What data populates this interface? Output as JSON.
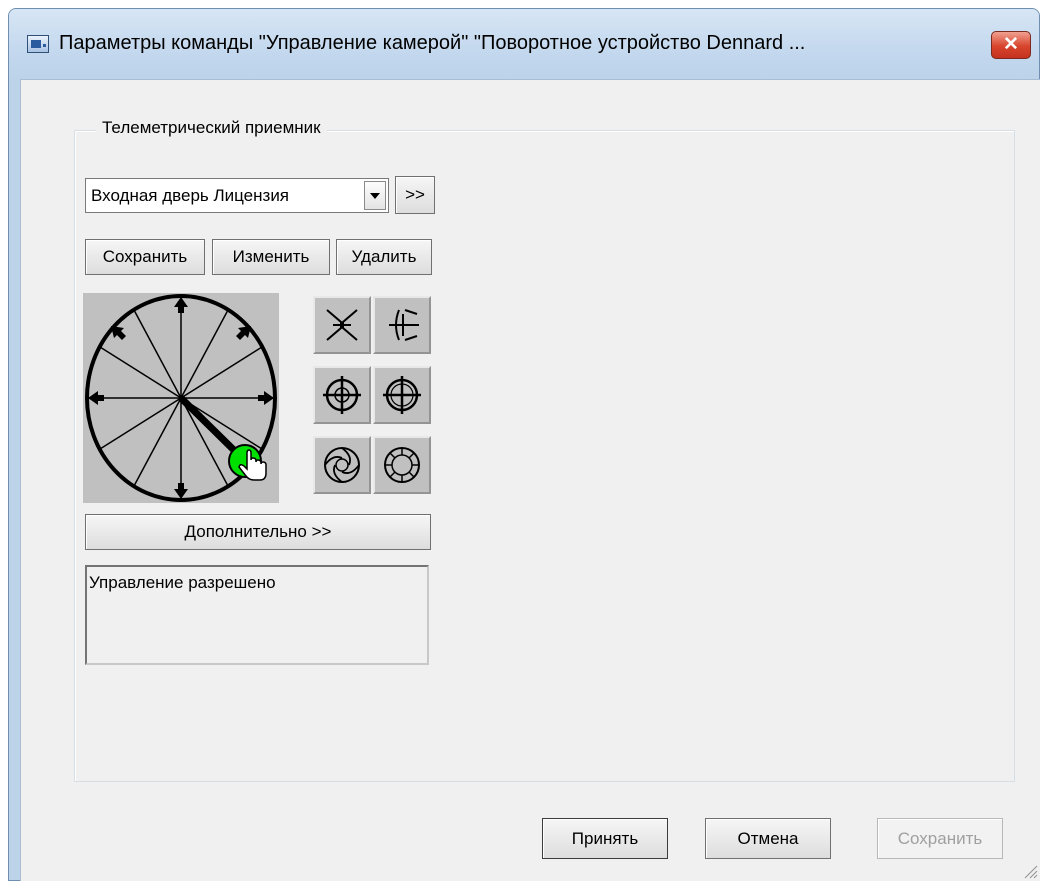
{
  "window": {
    "title": "Параметры команды \"Управление камерой\" \"Поворотное устройство Dennard ...",
    "close_label": "✕"
  },
  "telemetry": {
    "group_title": "Телеметрический приемник",
    "receiver_value": "Входная дверь Лицензия",
    "expand_label": ">>",
    "save_label": "Сохранить",
    "change_label": "Изменить",
    "delete_label": "Удалить"
  },
  "ptz": {
    "lens_buttons": [
      {
        "name": "zoom-out-icon"
      },
      {
        "name": "zoom-in-icon"
      },
      {
        "name": "focus-near-icon"
      },
      {
        "name": "focus-far-icon"
      },
      {
        "name": "iris-open-icon"
      },
      {
        "name": "iris-close-icon"
      }
    ],
    "joystick_color": "#00e000"
  },
  "more_label": "Дополнительно >>",
  "status_text": "Управление разрешено",
  "footer": {
    "ok_label": "Принять",
    "cancel_label": "Отмена",
    "save_label": "Сохранить"
  }
}
